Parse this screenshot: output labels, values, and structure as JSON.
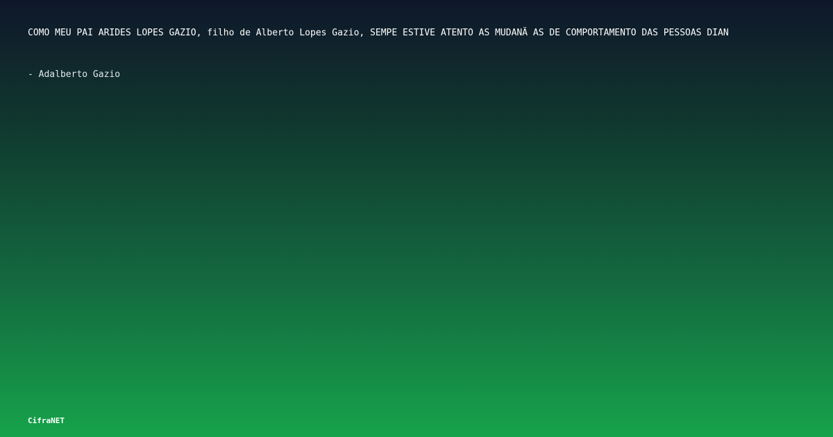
{
  "quote": {
    "text": "COMO MEU PAI ARIDES LOPES GAZIO, filho de Alberto Lopes Gazio, SEMPE ESTIVE ATENTO AS MUDANÃ AS DE COMPORTAMENTO DAS PESSOAS DIAN",
    "author_line": "- Adalberto Gazio"
  },
  "brand": {
    "name": "CifraNET"
  },
  "colors": {
    "gradient_top": "#0f172a",
    "gradient_bottom": "#16a34a",
    "text": "#ffffff",
    "author_text": "#e2e8f0"
  }
}
